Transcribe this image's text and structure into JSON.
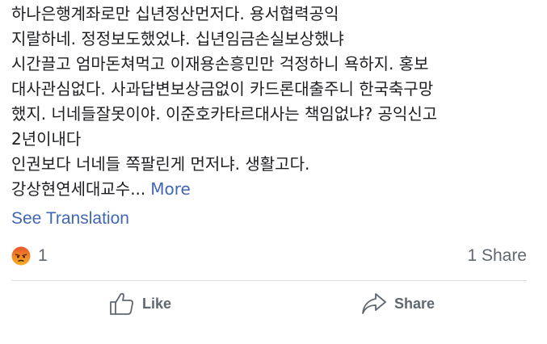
{
  "post": {
    "lines": [
      "하나은행계좌로만 십년정산먼저다. 용서협력공익",
      "지랄하네. 정정보도했었냐. 십년임금손실보상했냐",
      "시간끌고 엄마돈쳐먹고 이재용손흥민만 걱정하니 욕하지. 홍보",
      "대사관심없다. 사과답변보상금없이 카드론대출주니 한국축구망",
      "했지. 너네들잘못이야. 이준호카타르대사는 책임없냐? 공익신고",
      "2년이내다",
      "인권보다 너네들 쪽팔린게 먼저냐. 생활고다.",
      "강상현연세대교수..."
    ],
    "more_label": "More",
    "see_translation": "See Translation"
  },
  "reactions": {
    "icon": "angry-reaction-icon",
    "count": "1",
    "shares": "1 Share"
  },
  "actions": {
    "like_label": "Like",
    "share_label": "Share"
  },
  "colors": {
    "text": "#1c1e21",
    "link": "#4267b2",
    "muted": "#606770",
    "divider": "#dadde1",
    "angry_top": "#e8562a",
    "angry_bottom": "#f7b125"
  }
}
